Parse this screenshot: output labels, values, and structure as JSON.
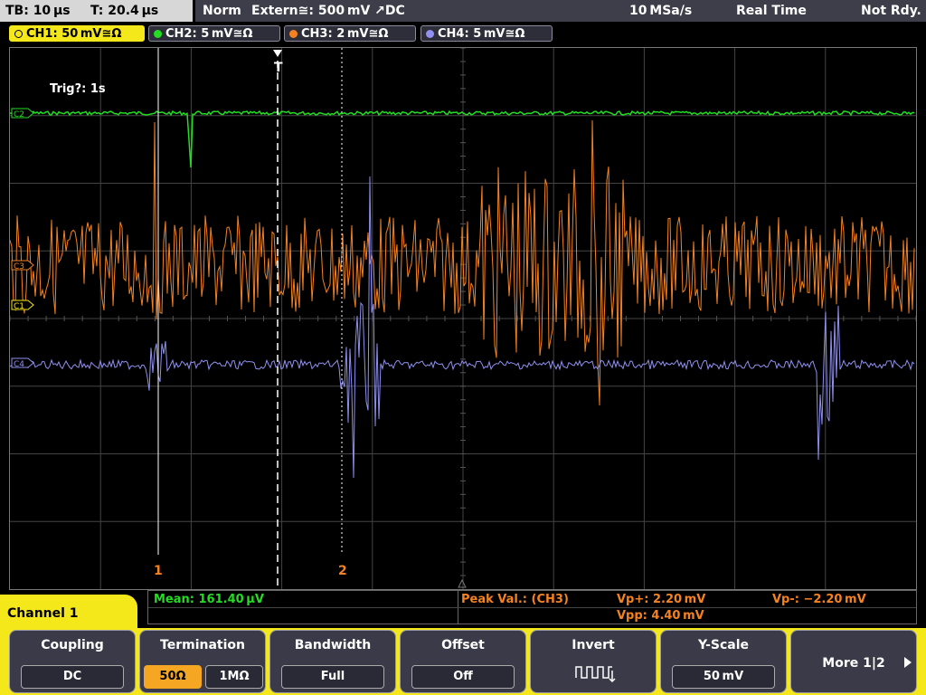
{
  "status": {
    "timebase": "TB: 10 µs",
    "trigger_time": "T: 20.4 µs",
    "trigger_mode": "Norm",
    "trigger_source": "Extern≅: 500 mV ↗DC",
    "sample_rate": "10 MSa/s",
    "acq_mode": "Real Time",
    "state": "Not Rdy."
  },
  "channels": [
    {
      "label": "CH1: 50 mV≅Ω",
      "color": "#f5e81a"
    },
    {
      "label": "CH2: 5 mV≅Ω",
      "color": "#22dd22"
    },
    {
      "label": "CH3: 2 mV≅Ω",
      "color": "#f58220"
    },
    {
      "label": "CH4: 5 mV≅Ω",
      "color": "#9090f0"
    }
  ],
  "display": {
    "trig_status": "Trig?: 1s",
    "trigger_marker": "T",
    "cursor1_label": "1",
    "cursor2_label": "2",
    "ch_markers": {
      "ch1": "C1",
      "ch2": "C2",
      "ch3": "C3",
      "ch4": "C4"
    }
  },
  "measurements": {
    "mean": "Mean: 161.40 µV",
    "peak_label": "Peak Val.:  (CH3)",
    "vp_plus": "Vp+: 2.20 mV",
    "vp_minus": "Vp-: −2.20 mV",
    "vpp": "Vpp: 4.40 mV"
  },
  "menu": {
    "channel": "Channel 1",
    "coupling": {
      "title": "Coupling",
      "value": "DC"
    },
    "termination": {
      "title": "Termination",
      "opt1": "50Ω",
      "opt2": "1MΩ"
    },
    "bandwidth": {
      "title": "Bandwidth",
      "value": "Full"
    },
    "offset": {
      "title": "Offset",
      "value": "Off"
    },
    "invert": {
      "title": "Invert"
    },
    "yscale": {
      "title": "Y-Scale",
      "value": "50 mV"
    },
    "more": "More 1|2"
  },
  "colors": {
    "ch1": "#f5e81a",
    "ch2": "#22dd22",
    "ch3": "#f58220",
    "ch4": "#9090f0",
    "accent": "#f5e81a"
  }
}
